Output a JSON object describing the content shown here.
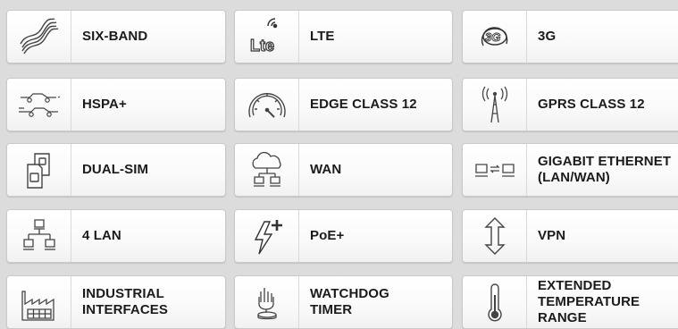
{
  "features": [
    {
      "icon": "waves-icon",
      "label": "SIX-BAND"
    },
    {
      "icon": "lte-icon",
      "label": "LTE",
      "icon_text": "Lte"
    },
    {
      "icon": "3g-icon",
      "label": "3G",
      "icon_text": "3G"
    },
    {
      "icon": "hspa-cars-icon",
      "label": "HSPA+"
    },
    {
      "icon": "speedometer-icon",
      "label": "EDGE CLASS 12"
    },
    {
      "icon": "antenna-tower-icon",
      "label": "GPRS CLASS 12"
    },
    {
      "icon": "sim-cards-icon",
      "label": "DUAL-SIM"
    },
    {
      "icon": "cloud-network-icon",
      "label": "WAN"
    },
    {
      "icon": "ethernet-icon",
      "label": "GIGABIT ETHERNET\n(LAN/WAN)"
    },
    {
      "icon": "lan-network-icon",
      "label": "4 LAN"
    },
    {
      "icon": "lightning-plus-icon",
      "label": "PoE+"
    },
    {
      "icon": "vertical-arrows-icon",
      "label": "VPN"
    },
    {
      "icon": "factory-icon",
      "label": "INDUSTRIAL\nINTERFACES"
    },
    {
      "icon": "hand-button-icon",
      "label": "WATCHDOG\nTIMER"
    },
    {
      "icon": "thermometer-icon",
      "label": "EXTENDED\nTEMPERATURE\nRANGE"
    }
  ]
}
